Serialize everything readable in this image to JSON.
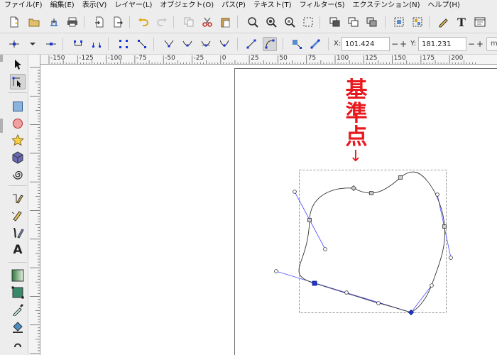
{
  "menu": [
    "ファイル(F)",
    "編集(E)",
    "表示(V)",
    "レイヤー(L)",
    "オブジェクト(O)",
    "パス(P)",
    "テキスト(T)",
    "フィルター(S)",
    "エクステンション(N)",
    "ヘルプ(H)"
  ],
  "tool_controls": {
    "x_label": "X:",
    "x_value": "101.424",
    "y_label": "Y:",
    "y_value": "181.231",
    "minus": "−",
    "plus": "+",
    "unit": "m"
  },
  "ruler_top_labels": [
    "-150",
    "-125",
    "-100",
    "-75",
    "-50",
    "-25",
    "0",
    "25",
    "50",
    "75",
    "100",
    "125",
    "150",
    "175",
    "200"
  ],
  "annotation": {
    "line1": "基",
    "line2": "準",
    "line3": "点",
    "arrow": "↓",
    "color": "#e8191e"
  },
  "colors": {
    "handle_line": "#4d4dff",
    "path": "#333333",
    "bbox": "#777777",
    "selected_node": "#1a36d6"
  },
  "icons": {
    "text_tool": "A",
    "text_button": "T"
  }
}
